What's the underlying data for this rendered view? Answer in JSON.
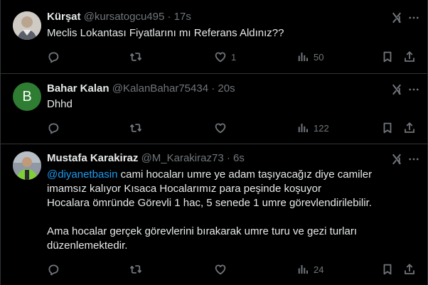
{
  "tweets": [
    {
      "name": "Kürşat",
      "handle": "@kursatogcu495",
      "dot": "·",
      "time": "17s",
      "text_lines": [
        "Meclis Lokantası Fiyatlarını mı Referans Aldınız??"
      ],
      "replies": "",
      "retweets": "",
      "likes": "1",
      "views": "50"
    },
    {
      "name": "Bahar Kalan",
      "handle": "@KalanBahar75434",
      "dot": "·",
      "time": "20s",
      "avatar_letter": "B",
      "text_lines": [
        "Dhhd"
      ],
      "replies": "",
      "retweets": "",
      "likes": "",
      "views": "122"
    },
    {
      "name": "Mustafa Karakiraz",
      "handle": "@M_Karakiraz73",
      "dot": "·",
      "time": "6s",
      "mention": "@diyanetbasin",
      "line1_rest": " cami hocaları umre ye adam taşıyacağız diye camiler",
      "line2": "imamsız kalıyor Kısaca Hocalarımız para peşinde koşuyor",
      "line3": "Hocalara ömründe Görevli 1 hac, 5 senede 1 umre görevlendirilebilir.",
      "line4": "Ama hocalar gerçek görevlerini bırakarak umre turu ve gezi turları",
      "line5": "düzenlemektedir.",
      "replies": "",
      "retweets": "",
      "likes": "",
      "views": "24"
    }
  ],
  "colors": {
    "background": "#000000",
    "text": "#e7e9ea",
    "muted": "#71767b",
    "link": "#1d9bf0",
    "border": "#2f3336",
    "avatar_b": "#2e7d32"
  },
  "icons": [
    "grok-icon",
    "more-icon",
    "reply-icon",
    "retweet-icon",
    "like-icon",
    "views-icon",
    "bookmark-icon",
    "share-icon"
  ]
}
